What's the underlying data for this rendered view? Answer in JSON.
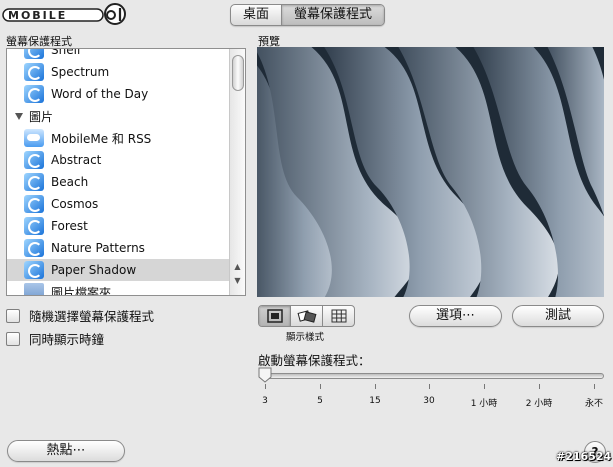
{
  "watermark": {
    "text": "MOBILE01"
  },
  "tabs": [
    {
      "label": "桌面",
      "active": false
    },
    {
      "label": "螢幕保護程式",
      "active": true
    }
  ],
  "screensaver_list": {
    "label": "螢幕保護程式",
    "items": [
      {
        "label": "Shell",
        "kind": "item",
        "icon": "screensaver-icon"
      },
      {
        "label": "Spectrum",
        "kind": "item",
        "icon": "screensaver-icon"
      },
      {
        "label": "Word of the Day",
        "kind": "item",
        "icon": "screensaver-icon"
      },
      {
        "label": "圖片",
        "kind": "group",
        "icon": "disclosure-triangle-icon"
      },
      {
        "label": "MobileMe 和 RSS",
        "kind": "item",
        "icon": "cloud-icon"
      },
      {
        "label": "Abstract",
        "kind": "item",
        "icon": "screensaver-icon"
      },
      {
        "label": "Beach",
        "kind": "item",
        "icon": "screensaver-icon"
      },
      {
        "label": "Cosmos",
        "kind": "item",
        "icon": "screensaver-icon"
      },
      {
        "label": "Forest",
        "kind": "item",
        "icon": "screensaver-icon"
      },
      {
        "label": "Nature Patterns",
        "kind": "item",
        "icon": "screensaver-icon"
      },
      {
        "label": "Paper Shadow",
        "kind": "item",
        "icon": "screensaver-icon",
        "selected": true
      },
      {
        "label": "圖片檔案夾",
        "kind": "item",
        "icon": "folder-icon"
      }
    ]
  },
  "options": {
    "random_label": "隨機選擇螢幕保護程式",
    "show_clock_label": "同時顯示時鐘"
  },
  "preview": {
    "label": "預覽"
  },
  "display_style": {
    "label": "顯示樣式",
    "selected": "single"
  },
  "buttons": {
    "options": "選項⋯",
    "test": "測試",
    "hot_corners": "熱點⋯",
    "help": "?"
  },
  "start_after": {
    "label": "啟動螢幕保護程式：",
    "ticks": [
      "3",
      "5",
      "15",
      "30",
      "1 小時",
      "2 小時",
      "永不"
    ],
    "selected": "3"
  },
  "stamp": "#216524"
}
